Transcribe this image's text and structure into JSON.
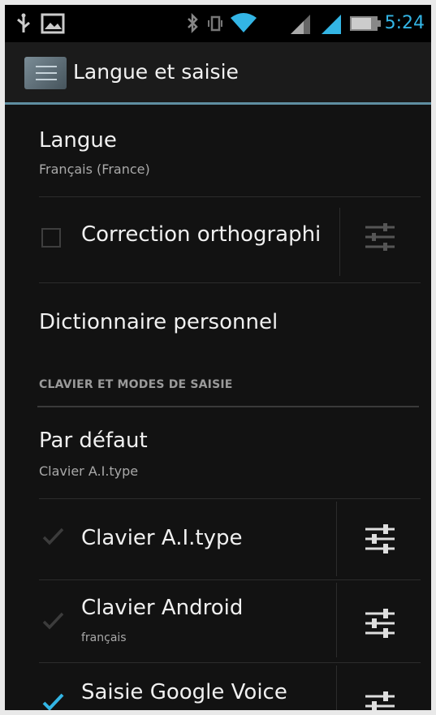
{
  "status_bar": {
    "time": "5:24",
    "accent_color": "#33b5e5",
    "icons": [
      "usb-icon",
      "picture-icon",
      "bluetooth-icon",
      "vibrate-icon",
      "wifi-icon",
      "signal-icon",
      "signal-icon",
      "battery-icon"
    ]
  },
  "action_bar": {
    "title": "Langue et saisie"
  },
  "items": {
    "langue": {
      "title": "Langue",
      "subtitle": "Français (France)"
    },
    "correction": {
      "title": "Correction orthographi",
      "checked": false
    },
    "dictionnaire": {
      "title": "Dictionnaire personnel"
    }
  },
  "section": {
    "header": "CLAVIER ET MODES DE SAISIE"
  },
  "keyboard": {
    "default": {
      "title": "Par défaut",
      "subtitle": "Clavier A.I.type"
    },
    "aitype": {
      "title": "Clavier A.I.type",
      "checked": true
    },
    "android": {
      "title": "Clavier Android",
      "subtitle": "français",
      "checked": true
    },
    "voice": {
      "title": "Saisie Google Voice",
      "checked": true
    }
  }
}
